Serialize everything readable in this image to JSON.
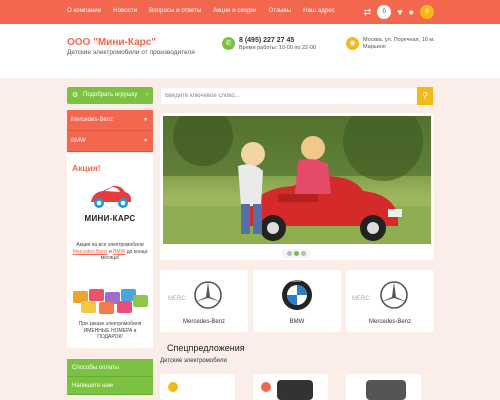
{
  "topnav": {
    "items": [
      "О компании",
      "Новости",
      "Вопросы и ответы",
      "Акции и скидки",
      "Отзывы",
      "Наш адрес"
    ]
  },
  "topbar": {
    "compare_count": "0",
    "wishlist_count": "0",
    "cart_count": "0"
  },
  "header": {
    "title": "ООО \"Мини-Карс\"",
    "subtitle": "Детские электромобили от производителя",
    "phone": "8 (495) 227 27 45",
    "hours": "Время работы: 10-00 по 22-00",
    "address": "Москва, ул. Поречная, 10 м. Марьино"
  },
  "sidebar": {
    "pick_toy_label": "Подобрать игрушку",
    "categories": [
      "Mercedes-Benz",
      "BMW"
    ],
    "promo": {
      "title": "Акция!",
      "logo_text": "МИНИ-КАРС",
      "text_before": "Акция на все электромобили",
      "link1": "Mercedes Benz",
      "text_and": "и",
      "link2": "BMW",
      "text_after": "до конца месяца!",
      "text2": "При заказе электромобиля ИМЕННЫЕ НОМЕРА в ПОДАРОК!"
    },
    "links": [
      "Способы оплаты",
      "Напишите нам"
    ]
  },
  "search": {
    "placeholder": "Введите ключевое слово..."
  },
  "slider": {
    "total": 3,
    "active": 2
  },
  "brands": [
    "Mercedes-Benz",
    "BMW",
    "Mercedes-Benz"
  ],
  "specials": {
    "title": "Спецпредложения",
    "subtitle": "Детские электромобили"
  },
  "colors": {
    "accent": "#f4674f",
    "green": "#7cc242",
    "yellow": "#f5b915"
  }
}
